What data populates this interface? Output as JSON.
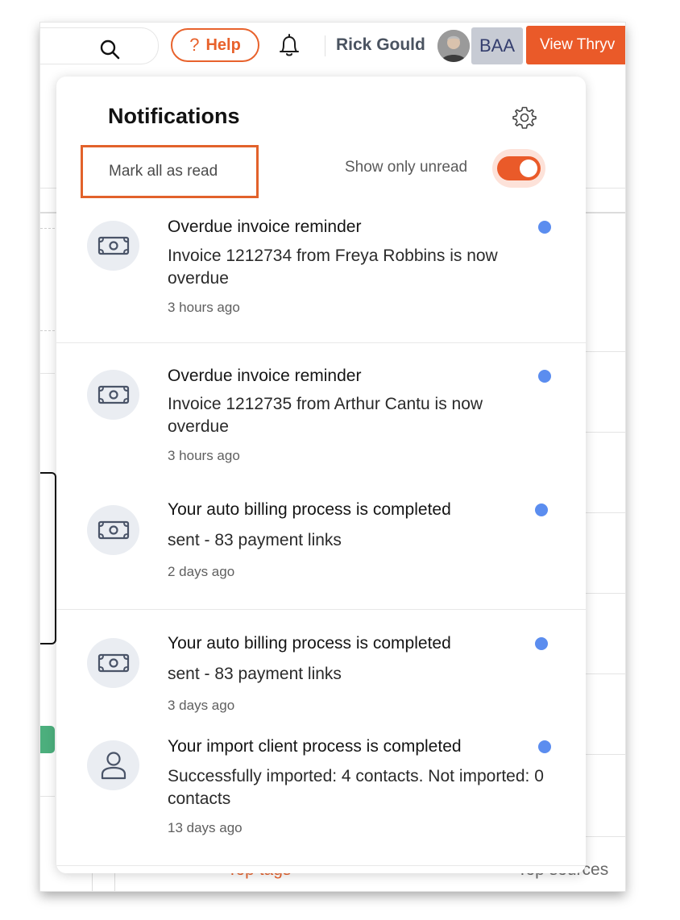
{
  "topbar": {
    "help_label": "Help",
    "help_symbol": "?",
    "user_name": "Rick Gould",
    "account_initials": "BAA",
    "view_button_label": "View Thryv"
  },
  "background": {
    "bottom_left_label": "Top tags",
    "bottom_right_label": "Top sources"
  },
  "panel": {
    "title": "Notifications",
    "mark_all_label": "Mark all as read",
    "show_unread_label": "Show only unread",
    "show_unread_on": true
  },
  "notifications": [
    {
      "icon": "money-icon",
      "title": "Overdue invoice reminder",
      "body": "Invoice 1212734 from Freya Robbins is now overdue",
      "time": "3 hours ago",
      "unread": true
    },
    {
      "icon": "money-icon",
      "title": "Overdue invoice reminder",
      "body": "Invoice 1212735 from Arthur Cantu is now overdue",
      "time": "3 hours ago",
      "unread": true
    },
    {
      "icon": "money-icon",
      "title": "Your auto billing process is completed",
      "body": "sent - 83 payment links",
      "time": "2 days ago",
      "unread": true
    },
    {
      "icon": "money-icon",
      "title": "Your auto billing process is completed",
      "body": "sent - 83 payment links",
      "time": "3 days ago",
      "unread": true
    },
    {
      "icon": "user-icon",
      "title": "Your import client process is completed",
      "body": "Successfully imported: 4 contacts. Not imported: 0 contacts",
      "time": "13 days ago",
      "unread": true
    }
  ],
  "colors": {
    "accent": "#ea5a29",
    "unread_dot": "#5b8def",
    "account_badge": "#c7cbd4"
  }
}
